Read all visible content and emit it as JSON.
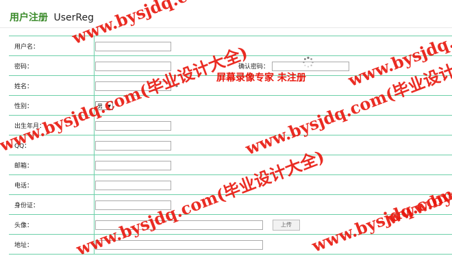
{
  "header": {
    "title_cn": "用户注册",
    "title_en": "UserReg"
  },
  "form": {
    "labels": {
      "username": "用户名：",
      "password": "密码：",
      "confirm_password": "确认密码：",
      "name": "姓名：",
      "gender": "性别：",
      "birthdate": "出生年月：",
      "qq": "QQ：",
      "email": "邮箱：",
      "phone": "电话：",
      "id_card": "身份证：",
      "avatar": "头像：",
      "address": "地址："
    },
    "required_mark": "*",
    "gender_value": "男",
    "upload_button": "上传"
  },
  "watermarks": {
    "site": "www.bysjdq.com(毕业设计大全)",
    "recorder": "屏幕录像专家  未注册"
  },
  "colors": {
    "title": "#3a8a2a",
    "grid_line": "#6bcfa8",
    "watermark": "#e8160c"
  },
  "icons": {
    "loading": "loading-spinner-icon"
  }
}
